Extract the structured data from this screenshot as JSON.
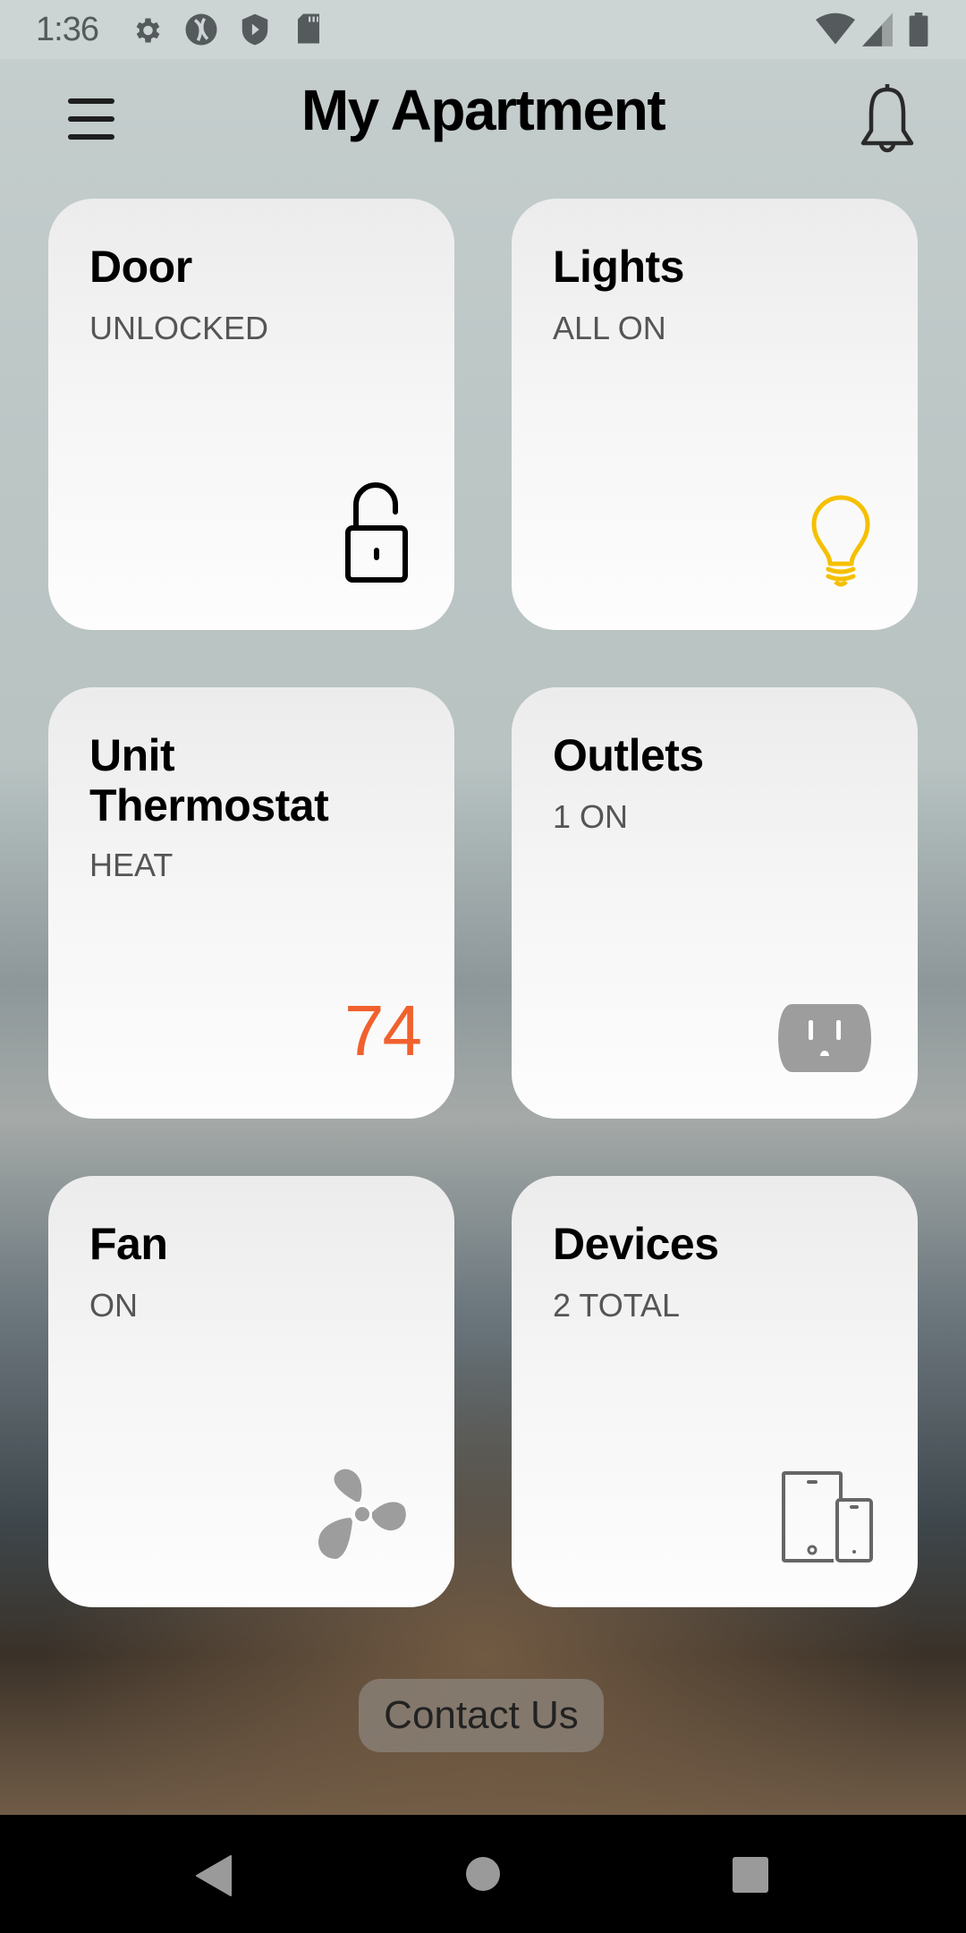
{
  "status_bar": {
    "time": "1:36",
    "left_icons": [
      "settings-gear-icon",
      "sync-app-icon",
      "shield-play-icon",
      "sd-card-icon"
    ],
    "right_icons": [
      "wifi-icon",
      "cellular-signal-icon",
      "battery-icon"
    ]
  },
  "header": {
    "title": "My Apartment",
    "menu_icon": "hamburger-menu-icon",
    "notifications_icon": "bell-icon"
  },
  "cards": [
    {
      "title": "Door",
      "status": "UNLOCKED",
      "icon": "unlocked-padlock-icon"
    },
    {
      "title": "Lights",
      "status": "ALL ON",
      "icon": "lightbulb-icon",
      "icon_color": "#f5c000"
    },
    {
      "title": "Unit Thermostat",
      "status": "HEAT",
      "value": "74",
      "value_color": "#f0612e"
    },
    {
      "title": "Outlets",
      "status": "1 ON",
      "icon": "power-outlet-icon"
    },
    {
      "title": "Fan",
      "status": "ON",
      "icon": "fan-icon"
    },
    {
      "title": "Devices",
      "status": "2 TOTAL",
      "icon": "tablet-phone-icon"
    }
  ],
  "contact_button": {
    "label": "Contact Us"
  },
  "nav_bar": {
    "icons": [
      "back-icon",
      "home-icon",
      "recents-icon"
    ]
  }
}
